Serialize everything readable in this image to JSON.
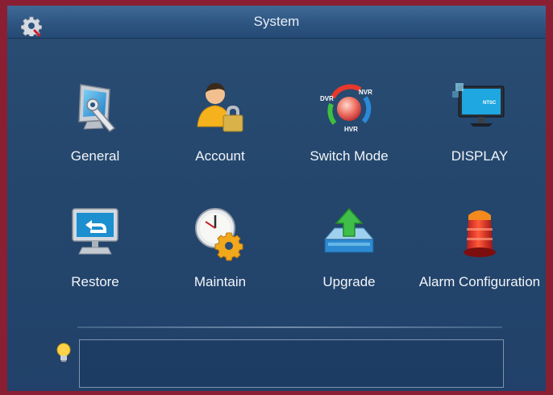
{
  "window": {
    "title": "System"
  },
  "icons": {
    "system": "gear-icon",
    "hint": "lightbulb-icon"
  },
  "menu": [
    {
      "label": "General",
      "icon": "monitor-wrench-icon"
    },
    {
      "label": "Account",
      "icon": "user-lock-icon"
    },
    {
      "label": "Switch Mode",
      "icon": "switch-mode-icon",
      "badges": [
        "DVR",
        "NVR",
        "HVR"
      ]
    },
    {
      "label": "DISPLAY",
      "icon": "display-monitor-icon",
      "screen_text": "NTSC"
    },
    {
      "label": "Restore",
      "icon": "restore-monitor-icon"
    },
    {
      "label": "Maintain",
      "icon": "clock-gear-icon"
    },
    {
      "label": "Upgrade",
      "icon": "upgrade-arrow-icon"
    },
    {
      "label": "Alarm Configuration",
      "icon": "alarm-siren-icon"
    }
  ],
  "tip": {
    "text": ""
  },
  "colors": {
    "background": "#24466c",
    "titlebar": "#2e5581",
    "frame": "#8a1f33",
    "label": "#f2f5f9"
  }
}
